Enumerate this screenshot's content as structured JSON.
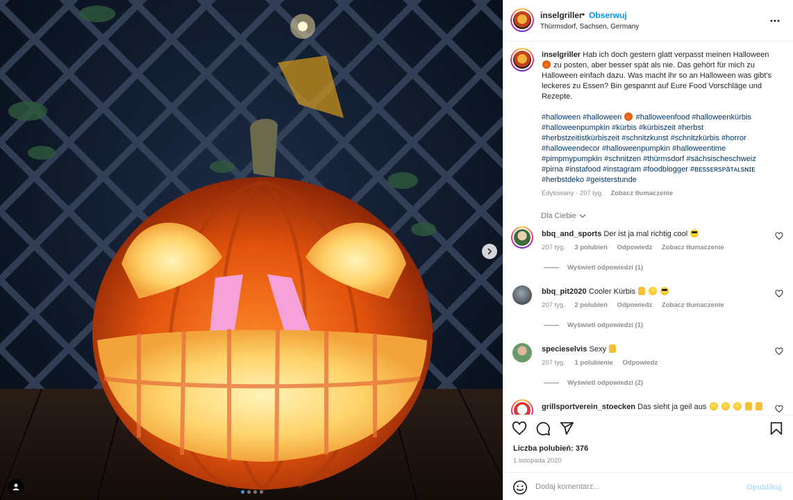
{
  "post": {
    "username": "inselgriller",
    "separator": "•",
    "follow_label": "Obserwuj",
    "location": "Thürmsdorf, Sachsen, Germany",
    "caption_user": "inselgriller",
    "caption_part1": "Hab ich doch gestern glatt verpasst meinen Halloween",
    "caption_part2": "zu posten, aber besser spät als nie. Das gehört für mich zu Halloween einfach dazu. Was macht ihr so an Halloween was gibt's leckeres zu Essen? Bin gespannt auf Eure Food Vorschläge und Rezepte.",
    "hashtags_1": "#halloween #halloween",
    "hashtags_2": "#halloweenfood #halloweenkürbis #halloweenpumpkin #kürbis #kürbiszeit #herbst #herbstzeitistkürbiszeit #schnitzkunst #schnitzkürbis #horror #halloweendecor #halloweenpumpkin #halloweentime #pimpmypumpkin #schnitzen #thürmsdorf #sächsischeschweiz #pirna #instafood #instagram #foodblogger #ʙᴇssᴇʀsᴘäᴛᴀʟsɴɪᴇ #herbstdeko #geisterstunde",
    "edited": "Edytowany · 207 tyg.",
    "see_translation": "Zobacz tłumaczenie",
    "likes": "Liczba polubień: 376",
    "date": "1 listopada 2020"
  },
  "dla_ciebie": "Dla Ciebie",
  "comments": [
    {
      "user": "bbq_and_sports",
      "text": "Der ist ja mal richtig cool",
      "age": "207 tyg.",
      "likes": "3 polubień",
      "reply": "Odpowiedz",
      "translate": "Zobacz tłumaczenie",
      "replies": "Wyświetl odpowiedzi (1)"
    },
    {
      "user": "bbq_pit2020",
      "text": "Cooler Kürbis",
      "age": "207 tyg.",
      "likes": "2 polubień",
      "reply": "Odpowiedz",
      "translate": "Zobacz tłumaczenie",
      "replies": "Wyświetl odpowiedzi (1)"
    },
    {
      "user": "specieselvis",
      "text": "Sexy",
      "age": "207 tyg.",
      "likes": "1 polubienie",
      "reply": "Odpowiedz",
      "replies": "Wyświetl odpowiedzi (2)"
    },
    {
      "user": "grillsportverein_stoecken",
      "text": "Das sieht ja geil aus"
    }
  ],
  "add_comment": {
    "placeholder": "Dodaj komentarz...",
    "post_label": "Opublikuj"
  },
  "colors": {
    "link": "#0095f6",
    "hashtag": "#00376b",
    "muted": "#8e8e8e",
    "active_dot": "#3897f0"
  },
  "icons": [
    "more-icon",
    "chevron-right-icon",
    "heart-icon",
    "comment-icon",
    "share-icon",
    "bookmark-icon",
    "emoji-icon",
    "user-tag-icon"
  ],
  "carousel": {
    "slides": 4,
    "active": 1
  }
}
